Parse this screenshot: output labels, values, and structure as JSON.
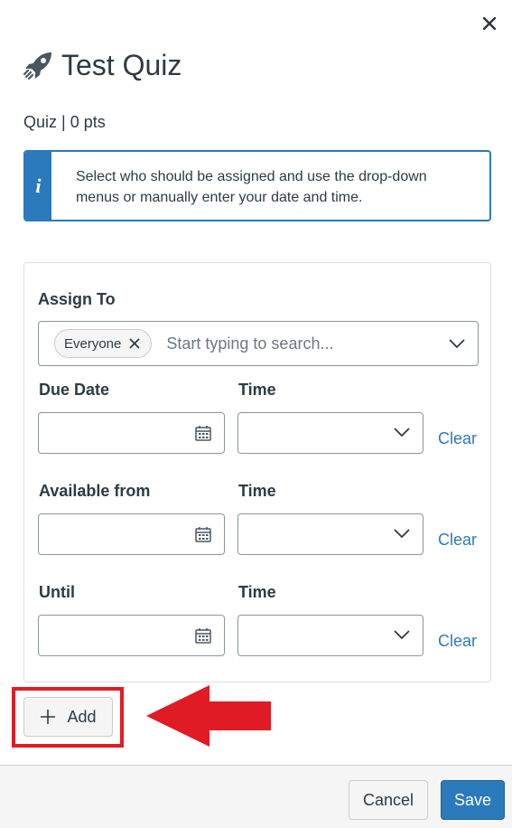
{
  "header": {
    "close_label": "×",
    "title": "Test Quiz",
    "subtitle": "Quiz | 0 pts"
  },
  "info": {
    "icon_letter": "i",
    "text": "Select who should be assigned and use the drop-down menus or manually enter your date and time."
  },
  "assign": {
    "label": "Assign To",
    "tag": "Everyone",
    "placeholder": "Start typing to search..."
  },
  "rows": [
    {
      "date_label": "Due Date",
      "time_label": "Time",
      "clear_label": "Clear"
    },
    {
      "date_label": "Available from",
      "time_label": "Time",
      "clear_label": "Clear"
    },
    {
      "date_label": "Until",
      "time_label": "Time",
      "clear_label": "Clear"
    }
  ],
  "add_label": "Add",
  "footer": {
    "cancel_label": "Cancel",
    "save_label": "Save"
  },
  "colors": {
    "accent": "#2b7abc",
    "highlight": "#e01b24",
    "text": "#2d3b45"
  },
  "icons": [
    "close-icon",
    "rocket-icon",
    "info-icon",
    "remove-tag-icon",
    "chevron-down-icon",
    "calendar-icon",
    "plus-icon",
    "red-arrow-annotation"
  ]
}
